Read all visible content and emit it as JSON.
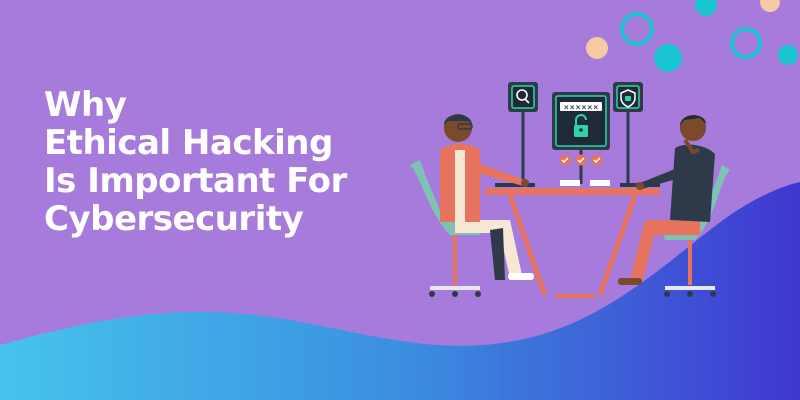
{
  "banner": {
    "title_lines": [
      "Why",
      "Ethical Hacking",
      "Is Important For",
      "Cybersecurity"
    ]
  },
  "screens": {
    "password_mask": "××××××"
  },
  "colors": {
    "background": "#a77bdb",
    "wave_light": "#43b6e6",
    "wave_dark": "#3f53d6",
    "teal": "#1bc6d3",
    "peach": "#f7c9a4",
    "title_text": "#ffffff",
    "desk": "#e8735f",
    "monitor": "#2e3a4a",
    "screen_green": "#2dd4a5"
  },
  "icons": [
    "magnifier-icon",
    "padlock-icon",
    "shield-icon",
    "checkmark-icon"
  ]
}
